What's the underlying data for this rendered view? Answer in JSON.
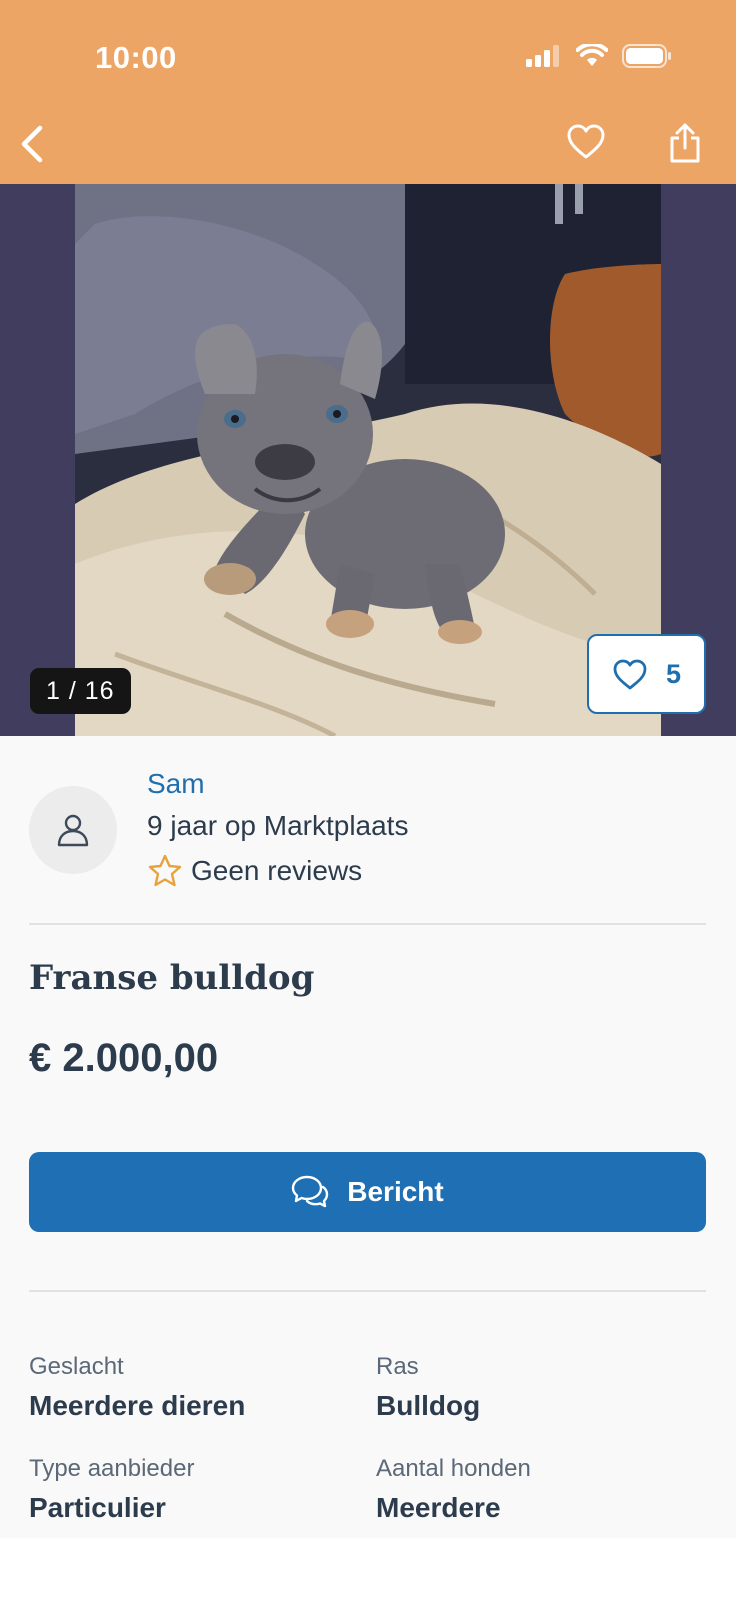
{
  "status": {
    "time": "10:00"
  },
  "colors": {
    "header": "#eda566",
    "accent": "#1f6fb5",
    "star": "#e8a23c"
  },
  "gallery": {
    "counter": "1 / 16",
    "likes": "5"
  },
  "seller": {
    "name": "Sam",
    "since": "9 jaar op Marktplaats",
    "reviews": "Geen reviews"
  },
  "listing": {
    "title": "Franse bulldog",
    "price": "€ 2.000,00",
    "message_button": "Bericht"
  },
  "attributes": [
    {
      "label": "Geslacht",
      "value": "Meerdere dieren"
    },
    {
      "label": "Ras",
      "value": "Bulldog"
    },
    {
      "label": "Type aanbieder",
      "value": "Particulier"
    },
    {
      "label": "Aantal honden",
      "value": "Meerdere"
    }
  ],
  "icons": [
    "back-icon",
    "heart-icon",
    "share-icon",
    "user-icon",
    "star-icon",
    "chat-icon"
  ]
}
